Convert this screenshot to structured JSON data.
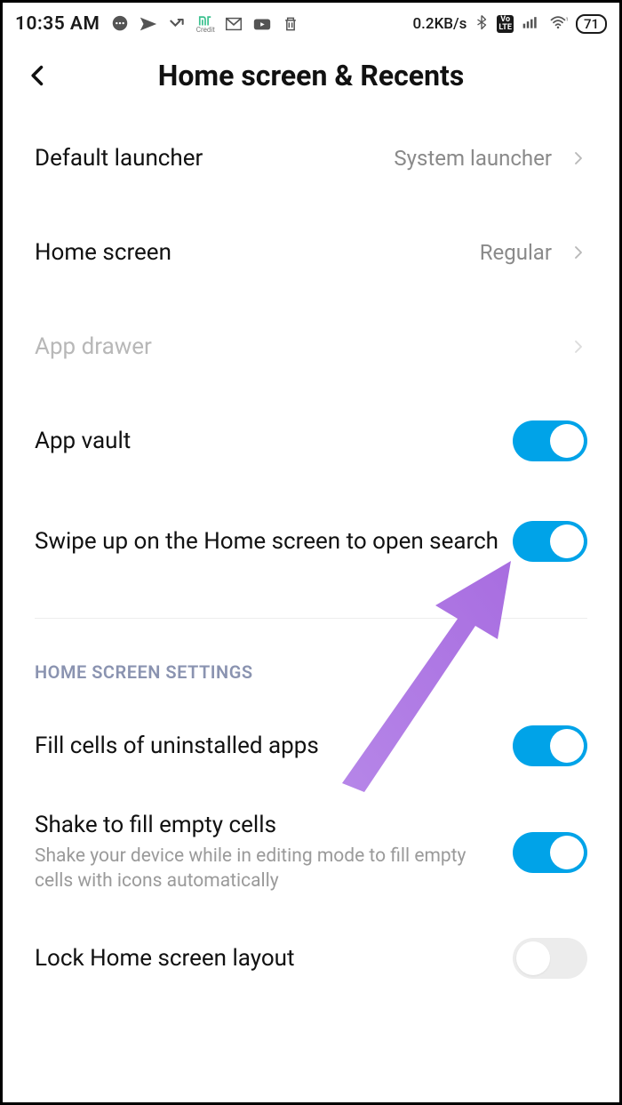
{
  "status_bar": {
    "time": "10:35 AM",
    "data_rate": "0.2KB/s",
    "battery": "71",
    "volte": "Vo LTE"
  },
  "header": {
    "title": "Home screen & Recents"
  },
  "rows": {
    "default_launcher": {
      "label": "Default launcher",
      "value": "System launcher"
    },
    "home_screen": {
      "label": "Home screen",
      "value": "Regular"
    },
    "app_drawer": {
      "label": "App drawer"
    },
    "app_vault": {
      "label": "App vault"
    },
    "swipe_search": {
      "label": "Swipe up on the Home screen to open search"
    },
    "fill_cells": {
      "label": "Fill cells of uninstalled apps"
    },
    "shake_fill": {
      "label": "Shake to fill empty cells",
      "sub": "Shake your device while in editing mode to fill empty cells with icons automatically"
    },
    "lock_layout": {
      "label": "Lock Home screen layout"
    }
  },
  "section": {
    "home_screen_settings": "HOME SCREEN SETTINGS"
  },
  "annotation": {
    "arrow_color": "#b686e8"
  }
}
